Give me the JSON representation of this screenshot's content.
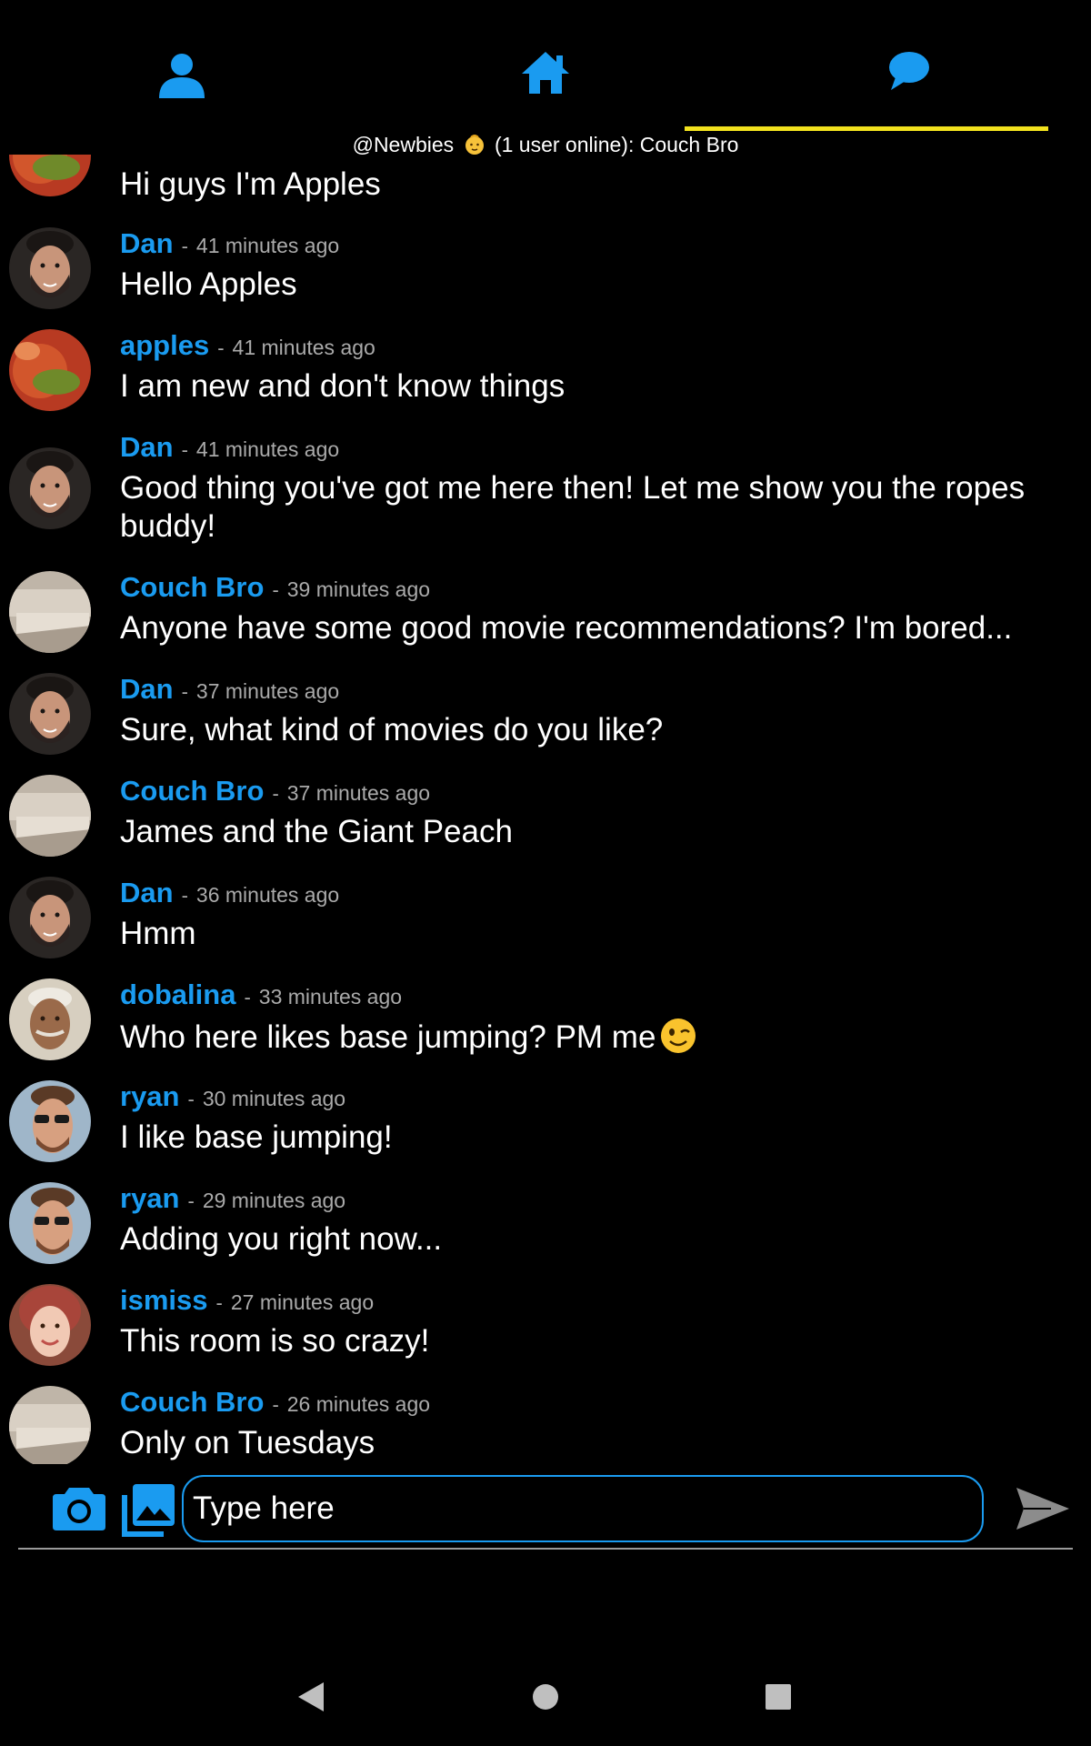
{
  "nav": {
    "tabs": [
      {
        "name": "profile",
        "icon": "person-icon"
      },
      {
        "name": "home",
        "icon": "home-icon"
      },
      {
        "name": "chat",
        "icon": "chat-bubble-icon",
        "active": true
      }
    ]
  },
  "room": {
    "name": "@Newbies",
    "emoji": "baby-emoji",
    "status": "(1 user online): Couch Bro"
  },
  "messages": [
    {
      "user": "",
      "time": "",
      "text": "Hi guys I'm Apples",
      "avatar": "apples"
    },
    {
      "user": "Dan",
      "time": "41 minutes ago",
      "text": "Hello Apples",
      "avatar": "dan"
    },
    {
      "user": "apples",
      "time": "41 minutes ago",
      "text": "I am new and don't know things",
      "avatar": "apples"
    },
    {
      "user": "Dan",
      "time": "41 minutes ago",
      "text": "Good thing you've got me here then! Let me show you the ropes buddy!",
      "avatar": "dan"
    },
    {
      "user": "Couch Bro",
      "time": "39 minutes ago",
      "text": "Anyone have some good movie recommendations? I'm bored...",
      "avatar": "couch"
    },
    {
      "user": "Dan",
      "time": "37 minutes ago",
      "text": "Sure, what kind of movies do you like?",
      "avatar": "dan"
    },
    {
      "user": "Couch Bro",
      "time": "37 minutes ago",
      "text": "James and the Giant Peach",
      "avatar": "couch"
    },
    {
      "user": "Dan",
      "time": "36 minutes ago",
      "text": "Hmm",
      "avatar": "dan"
    },
    {
      "user": "dobalina",
      "time": "33 minutes ago",
      "text": "Who here likes base jumping? PM me",
      "avatar": "dobalina",
      "emoji": "winking-face-emoji"
    },
    {
      "user": "ryan",
      "time": "30 minutes ago",
      "text": "I like base jumping!",
      "avatar": "ryan"
    },
    {
      "user": "ryan",
      "time": "29 minutes ago",
      "text": "Adding you right now...",
      "avatar": "ryan"
    },
    {
      "user": "ismiss",
      "time": "27 minutes ago",
      "text": "This room is so crazy!",
      "avatar": "ismiss"
    },
    {
      "user": "Couch Bro",
      "time": "26 minutes ago",
      "text": "Only on Tuesdays",
      "avatar": "couch"
    }
  ],
  "separator": "-",
  "composer": {
    "placeholder": "Type here",
    "camera_icon": "camera-icon",
    "gallery_icon": "gallery-icon",
    "send_icon": "send-icon"
  },
  "system_nav": [
    "back-icon",
    "home-circle-icon",
    "recents-icon"
  ],
  "colors": {
    "accent": "#1a9bf0",
    "active_tab_underline": "#f2e21e",
    "timestamp": "#aaaaaa",
    "background": "#000000"
  }
}
